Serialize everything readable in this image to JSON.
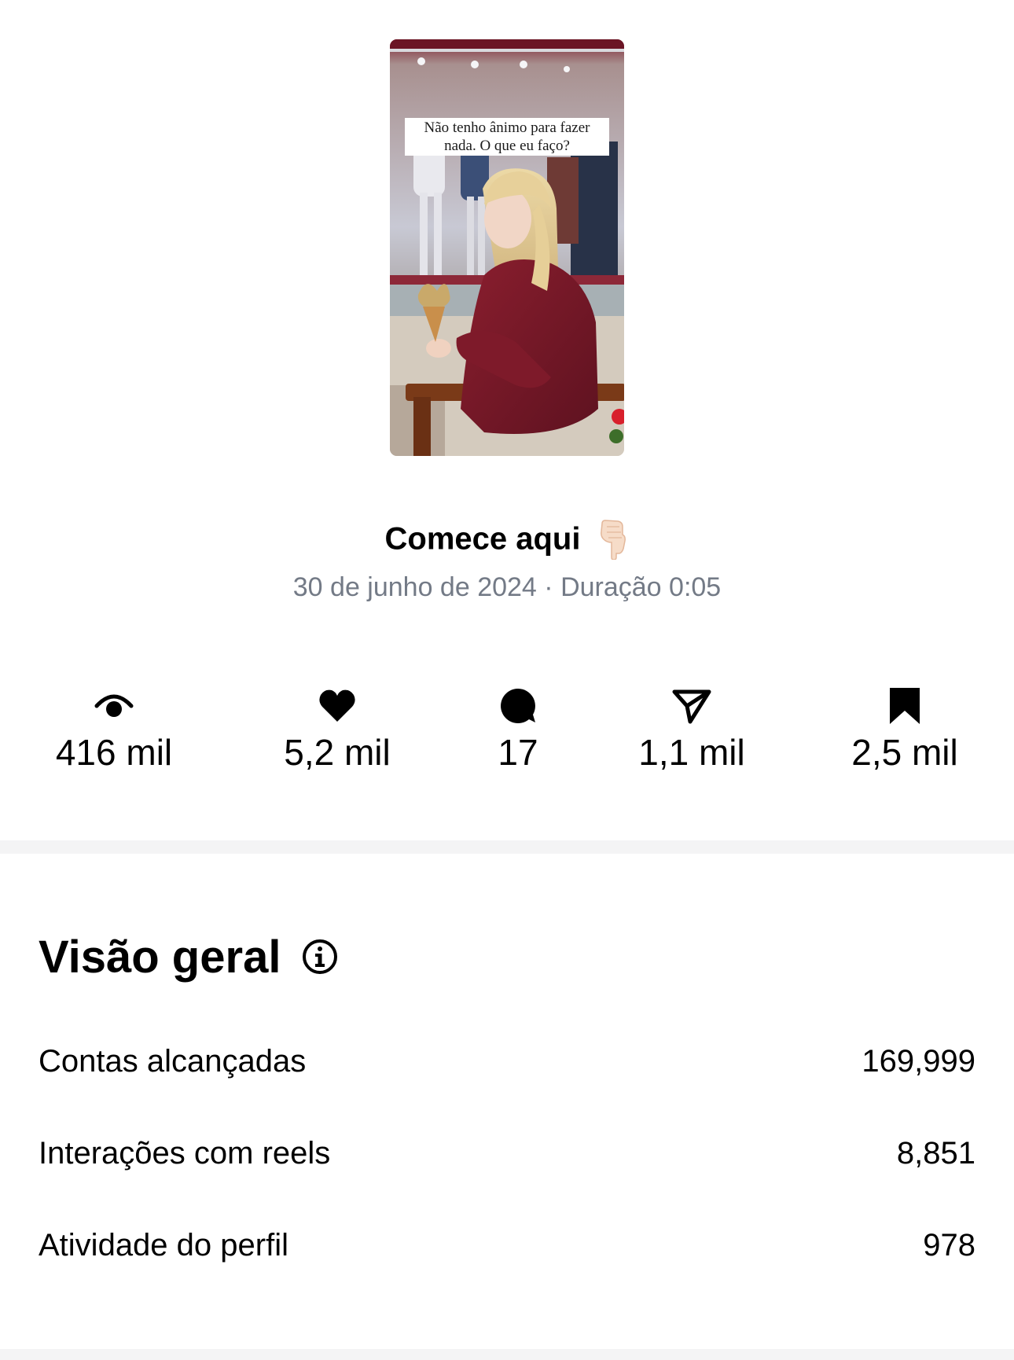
{
  "reel": {
    "thumbnail_caption": "Não tenho ânimo para fazer nada. O que eu faço?",
    "title": "Comece aqui",
    "title_emoji": "pointing-down-hand-emoji",
    "date": "30 de junho de 2024",
    "separator": "·",
    "duration_label": "Duração",
    "duration": "0:05"
  },
  "metrics": [
    {
      "icon": "eye-icon",
      "value": "416 mil"
    },
    {
      "icon": "heart-icon",
      "value": "5,2 mil"
    },
    {
      "icon": "comment-icon",
      "value": "17"
    },
    {
      "icon": "share-icon",
      "value": "1,1 mil"
    },
    {
      "icon": "bookmark-icon",
      "value": "2,5 mil"
    }
  ],
  "overview": {
    "title": "Visão geral",
    "info_icon": "info-icon",
    "rows": [
      {
        "label": "Contas alcançadas",
        "value": "169,999"
      },
      {
        "label": "Interações com reels",
        "value": "8,851"
      },
      {
        "label": "Atividade do perfil",
        "value": "978"
      }
    ]
  },
  "colors": {
    "text": "#000000",
    "secondary_text": "#737a86",
    "divider": "#f4f4f5",
    "background": "#ffffff"
  }
}
